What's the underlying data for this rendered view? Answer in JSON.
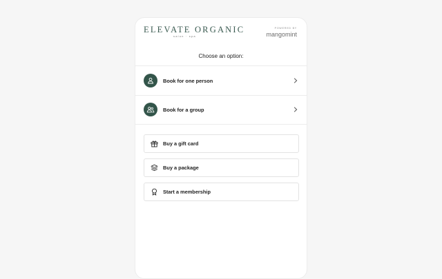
{
  "header": {
    "brand": "ELEVATE ORGANIC",
    "brand_sub": "salon · spa",
    "powered_label": "POWERED BY",
    "powered_name": "mangomint"
  },
  "prompt": "Choose an option:",
  "book_options": [
    {
      "label": "Book for one person",
      "icon": "person-icon"
    },
    {
      "label": "Book for a group",
      "icon": "group-icon"
    }
  ],
  "other_options": [
    {
      "label": "Buy a gift card",
      "icon": "gift-icon"
    },
    {
      "label": "Buy a package",
      "icon": "package-icon"
    },
    {
      "label": "Start a membership",
      "icon": "membership-icon"
    }
  ],
  "colors": {
    "accent": "#33554a",
    "background": "#f6f6f6",
    "border": "#e3e3e3"
  }
}
